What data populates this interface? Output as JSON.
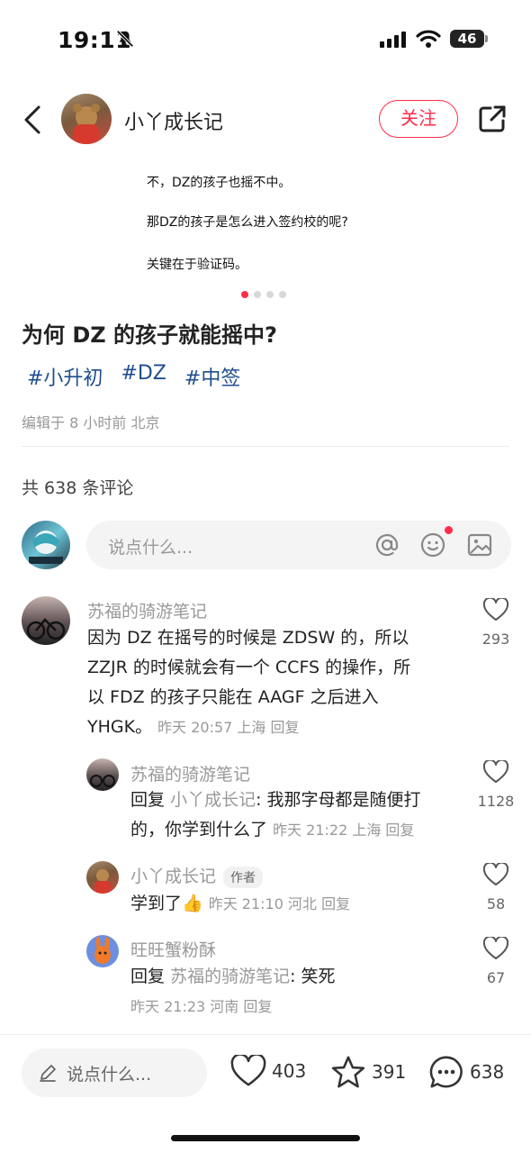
{
  "status_bar": {
    "time": "19:11",
    "battery": "46"
  },
  "header": {
    "author_name": "小丫成长记",
    "follow_label": "关注"
  },
  "image_text": {
    "line1": "不，DZ的孩子也摇不中。",
    "line2": "那DZ的孩子是怎么进入签约校的呢?",
    "line3": "关键在于验证码。"
  },
  "post": {
    "title": "为何 DZ 的孩子就能摇中?",
    "tags": [
      "#小升初",
      "#DZ",
      "#中签"
    ],
    "edit_info": "编辑于 8 小时前 北京",
    "comment_count": "共 638 条评论"
  },
  "comment_input": {
    "placeholder": "说点什么..."
  },
  "comments": [
    {
      "name": "苏福的骑游笔记",
      "lines": [
        "因为 DZ 在摇号的时候是 ZDSW 的，所以",
        "ZZJR 的时候就会有一个 CCFS 的操作，所",
        "以 FDZ 的孩子只能在 AAGF 之后进入"
      ],
      "last_line": "YHGK。",
      "meta": "昨天 20:57 上海 回复",
      "likes": "293"
    },
    {
      "name": "苏福的骑游笔记",
      "reply_prefix": "回复",
      "reply_to": "小丫成长记",
      "line1_text": ": 我那字母都是随便打",
      "line2_text": "的，你学到什么了",
      "meta": "昨天 21:22 上海 回复",
      "likes": "1128"
    },
    {
      "name": "小丫成长记",
      "author_tag": "作者",
      "text": "学到了👍",
      "meta": "昨天 21:10 河北 回复",
      "likes": "58"
    },
    {
      "name": "旺旺蟹粉酥",
      "reply_prefix": "回复",
      "reply_to": "苏福的骑游笔记",
      "line1_text": ": 笑死",
      "meta": "昨天 21:23 河南 回复",
      "likes": "67"
    }
  ],
  "bottom_bar": {
    "placeholder": "说点什么...",
    "likes": "403",
    "favorites": "391",
    "comments": "638"
  },
  "colors": {
    "accent": "#ff2d4a",
    "tag": "#1f4e8c",
    "muted": "#999999"
  }
}
